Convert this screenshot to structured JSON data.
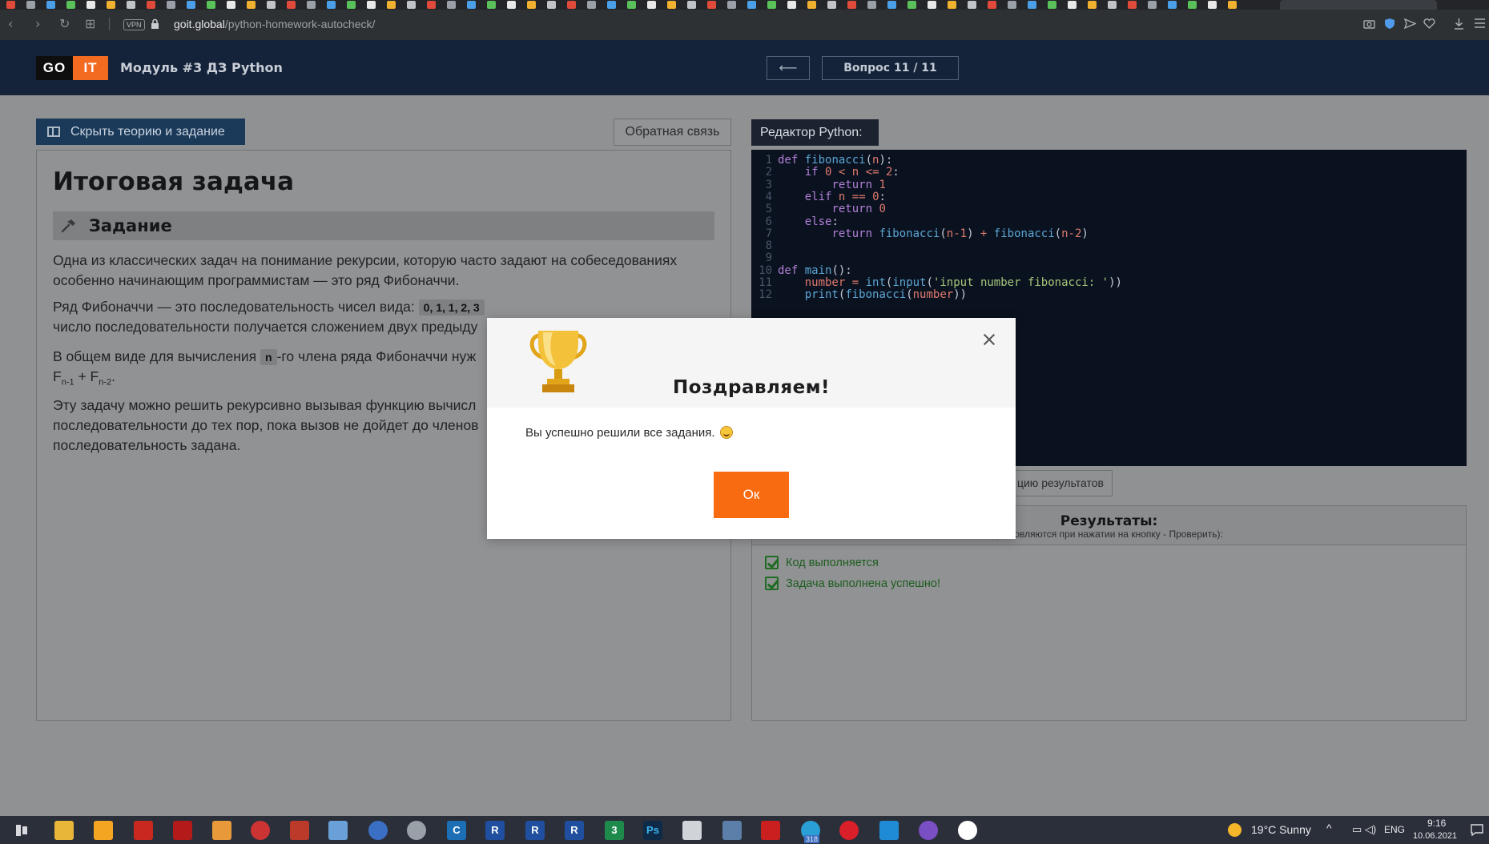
{
  "browser": {
    "vpn_label": "VPN",
    "url_host": "goit.global",
    "url_path": "/python-homework-autocheck/",
    "back_glyph": "‹",
    "forward_glyph": "›",
    "reload_glyph": "↻",
    "grid_glyph": "⊞",
    "tools": [
      "camera-icon",
      "shield-icon",
      "send-icon",
      "heart-icon",
      "download-icon",
      "menu-icon"
    ]
  },
  "header": {
    "logo_go": "GO",
    "logo_it": "IT",
    "title": "Модуль #3 ДЗ Python",
    "prev_glyph": "⟵",
    "question_counter": "Вопрос 11 / 11"
  },
  "toolbar": {
    "hide_theory_label": "Скрыть теорию и задание",
    "feedback_label": "Обратная связь"
  },
  "theory": {
    "title": "Итоговая задача",
    "task_heading": "Задание",
    "p1": "Одна из классических задач на понимание рекурсии, которую часто задают на собеседованиях особенно начинающим программистам — это ряд Фибоначчи.",
    "p2_before": "Ряд Фибоначчи — это последовательность чисел вида:",
    "p2_chip": "0, 1, 1, 2, 3",
    "p2_after": "число последовательности получается сложением двух предыду",
    "p3_before": "В общем виде для вычисления",
    "p3_chip": "n",
    "p3_after": "-го члена ряда Фибоначчи нуж",
    "p3_formula_a": "F",
    "p3_sub_a": "n-1",
    "p3_formula_plus": " + F",
    "p3_sub_b": "n-2",
    "p3_formula_end": ".",
    "p4_line1": "Эту задачу можно решить рекурсивно вызывая функцию вычисл",
    "p4_line2": "последовательности до тех пор, пока вызов не дойдет до членов",
    "p4_line3": "последовательность задана."
  },
  "editor": {
    "tab_label": "Редактор Python:",
    "line_numbers": [
      "1",
      "2",
      "3",
      "4",
      "5",
      "6",
      "7",
      "8",
      "9",
      "10",
      "11",
      "12"
    ],
    "lines": [
      "def fibonacci(n):",
      "    if 0 < n <= 2:",
      "        return 1",
      "    elif n == 0:",
      "        return 0",
      "    else:",
      "        return fibonacci(n-1) + fibonacci(n-2)",
      "",
      "",
      "def main():",
      "    number = int(input('input number fibonacci: '))",
      "    print(fibonacci(number))"
    ]
  },
  "results": {
    "display_button_label": "цию результатов",
    "title": "Результаты:",
    "subtitle": "(обновляются при нажатии на кнопку - Проверить):",
    "items": [
      "Код выполняется",
      "Задача выполнена успешно!"
    ]
  },
  "modal": {
    "title": "Поздравляем!",
    "message": "Вы успешно решили все задания.",
    "ok_label": "Ок"
  },
  "taskbar": {
    "weather": "19°C  Sunny",
    "lang": "ENG",
    "time": "9:16",
    "date": "10.06.2021",
    "badge": "318"
  },
  "colors": {
    "header_bg": "#14233a",
    "accent_orange": "#f86b11",
    "success_green": "#1d5d1f",
    "editor_bg": "#0a1220"
  }
}
